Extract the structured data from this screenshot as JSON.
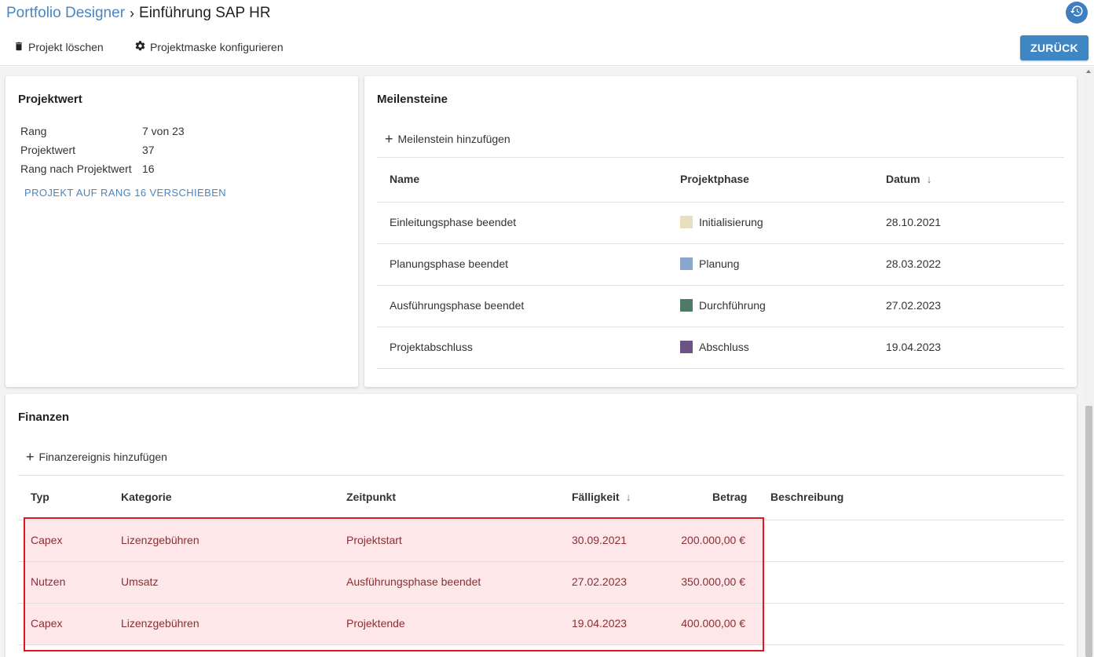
{
  "header": {
    "breadcrumb_link": "Portfolio Designer",
    "breadcrumb_sep": "›",
    "title": "Einführung SAP HR",
    "delete_label": "Projekt löschen",
    "configure_label": "Projektmaske konfigurieren",
    "back_label": "ZURÜCK"
  },
  "projektwert": {
    "title": "Projektwert",
    "rows": [
      {
        "label": "Rang",
        "value": "7 von 23"
      },
      {
        "label": "Projektwert",
        "value": "37"
      },
      {
        "label": "Rang nach Projektwert",
        "value": "16"
      }
    ],
    "link": "PROJEKT AUF RANG 16 VERSCHIEBEN"
  },
  "meilensteine": {
    "title": "Meilensteine",
    "add_label": "Meilenstein hinzufügen",
    "columns": [
      "Name",
      "Projektphase",
      "Datum"
    ],
    "rows": [
      {
        "name": "Einleitungsphase beendet",
        "phase": "Initialisierung",
        "color": "#e8dfbf",
        "date": "28.10.2021"
      },
      {
        "name": "Planungsphase beendet",
        "phase": "Planung",
        "color": "#8aa6cc",
        "date": "28.03.2022"
      },
      {
        "name": "Ausführungsphase beendet",
        "phase": "Durchführung",
        "color": "#4e7b67",
        "date": "27.02.2023"
      },
      {
        "name": "Projektabschluss",
        "phase": "Abschluss",
        "color": "#6b5484",
        "date": "19.04.2023"
      }
    ]
  },
  "finanzen": {
    "title": "Finanzen",
    "add_label": "Finanzereignis hinzufügen",
    "columns": [
      "Typ",
      "Kategorie",
      "Zeitpunkt",
      "Fälligkeit",
      "Betrag",
      "Beschreibung"
    ],
    "rows": [
      {
        "typ": "Capex",
        "kategorie": "Lizenzgebühren",
        "zeitpunkt": "Projektstart",
        "faelligkeit": "30.09.2021",
        "betrag": "200.000,00 €",
        "beschreibung": ""
      },
      {
        "typ": "Nutzen",
        "kategorie": "Umsatz",
        "zeitpunkt": "Ausführungsphase beendet",
        "faelligkeit": "27.02.2023",
        "betrag": "350.000,00 €",
        "beschreibung": ""
      },
      {
        "typ": "Capex",
        "kategorie": "Lizenzgebühren",
        "zeitpunkt": "Projektende",
        "faelligkeit": "19.04.2023",
        "betrag": "400.000,00 €",
        "beschreibung": ""
      }
    ]
  },
  "sort_arrow": "↓",
  "colors": {
    "accent": "#3f86c4",
    "highlight_border": "#e0151d",
    "highlight_fill": "#fde7e8"
  }
}
